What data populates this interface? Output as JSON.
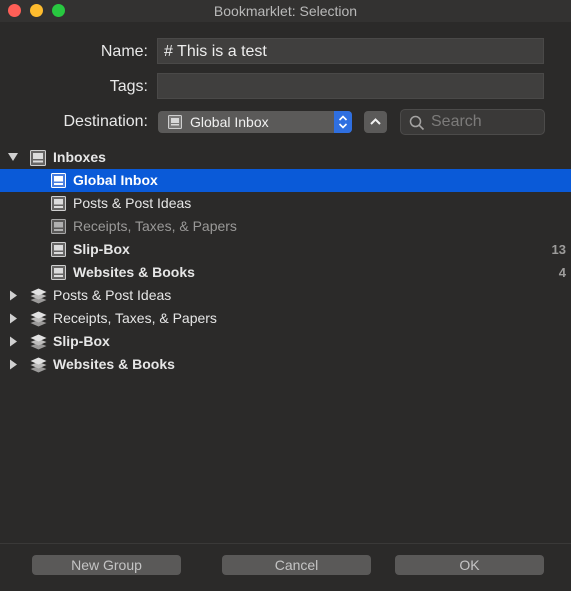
{
  "window": {
    "title": "Bookmarklet: Selection"
  },
  "form": {
    "name_label": "Name:",
    "name_value": "# This is a test",
    "tags_label": "Tags:",
    "tags_value": "",
    "destination_label": "Destination:",
    "destination_value": "Global Inbox",
    "search_placeholder": "Search"
  },
  "tree": {
    "inboxes": {
      "label": "Inboxes",
      "expanded": true,
      "children": [
        {
          "label": "Global Inbox",
          "selected": true,
          "count": ""
        },
        {
          "label": "Posts & Post Ideas",
          "count": ""
        },
        {
          "label": "Receipts, Taxes, & Papers",
          "count": ""
        },
        {
          "label": "Slip-Box",
          "count": "13"
        },
        {
          "label": "Websites & Books",
          "count": "4"
        }
      ]
    },
    "databases": [
      {
        "label": "Posts & Post Ideas"
      },
      {
        "label": "Receipts, Taxes, & Papers"
      },
      {
        "label": "Slip-Box"
      },
      {
        "label": "Websites & Books"
      }
    ]
  },
  "buttons": {
    "new_group": "New Group",
    "cancel": "Cancel",
    "ok": "OK"
  },
  "colors": {
    "selection": "#0a5ad8",
    "stepper": "#2f6fe0",
    "close": "#fe5f57",
    "minimize": "#febc2e",
    "maximize": "#28c840"
  },
  "icons": {
    "inbox": "inbox-icon",
    "database": "stack-icon",
    "search": "search-icon",
    "disclosure_open": "triangle-down-icon",
    "disclosure_closed": "triangle-right-icon"
  }
}
